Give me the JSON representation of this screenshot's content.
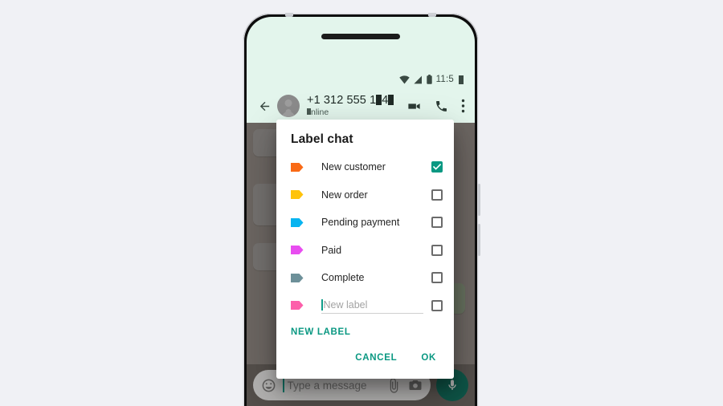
{
  "device": {
    "status_bar": {
      "time": "11:5",
      "time_redacted": true,
      "icons": [
        "wifi-icon",
        "cellular-signal-icon",
        "battery-icon"
      ]
    },
    "chat_header": {
      "back_icon": "back-arrow-icon",
      "contact_name": "+1 312 555 1",
      "contact_name_redacted_suffix": "4",
      "presence": "nline",
      "presence_prefix_redacted": true,
      "actions": [
        "video-call-icon",
        "voice-call-icon",
        "overflow-menu-icon"
      ]
    },
    "input_bar": {
      "emoji_icon": "emoji-smiley-icon",
      "placeholder": "Type a message",
      "attach_icon": "paperclip-icon",
      "camera_icon": "camera-icon",
      "mic_icon": "microphone-icon"
    }
  },
  "dialog": {
    "title": "Label chat",
    "labels": [
      {
        "name": "New customer",
        "color": "#f96a16",
        "checked": true
      },
      {
        "name": "New order",
        "color": "#ffc30b",
        "checked": false
      },
      {
        "name": "Pending payment",
        "color": "#08b4f0",
        "checked": false
      },
      {
        "name": "Paid",
        "color": "#e84df0",
        "checked": false
      },
      {
        "name": "Complete",
        "color": "#6d9099",
        "checked": false
      }
    ],
    "new_label_row": {
      "color": "#fc5faa",
      "placeholder": "New label",
      "value": "",
      "checked": false
    },
    "new_label_button": "NEW LABEL",
    "cancel_button": "CANCEL",
    "ok_button": "OK",
    "accent_color": "#0a9882"
  }
}
